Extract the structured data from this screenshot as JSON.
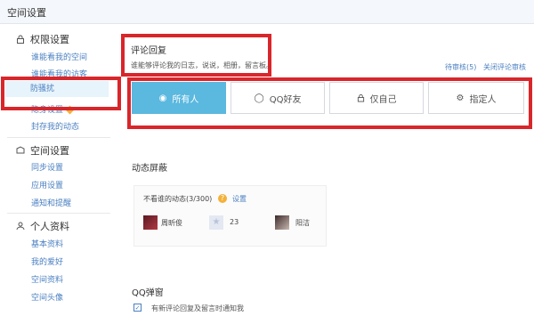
{
  "window": {
    "title": "空间设置"
  },
  "sidebar": {
    "sections": [
      {
        "title": "权限设置",
        "icon": "lock-icon",
        "items": [
          "谁能看我的空间",
          "谁能看我的访客",
          "防骚扰",
          "隐身设置",
          "封存我的动态"
        ]
      },
      {
        "title": "空间设置",
        "icon": "space-icon",
        "items": [
          "同步设置",
          "应用设置",
          "通知和提醒"
        ]
      },
      {
        "title": "个人资料",
        "icon": "person-icon",
        "items": [
          "基本资料",
          "我的爱好",
          "空间资料",
          "空间头像"
        ]
      }
    ],
    "active_item": "防骚扰"
  },
  "comment_reply": {
    "title": "评论回复",
    "description": "谁能够评论我的日志，说说，相册，留言板。",
    "pending_link": "待审核(5)",
    "close_review_link": "关闭评论审核",
    "options": [
      {
        "label": "所有人",
        "icon": "globe-icon",
        "selected": true
      },
      {
        "label": "QQ好友",
        "icon": "bubble-icon",
        "selected": false
      },
      {
        "label": "仅自己",
        "icon": "lock-icon",
        "selected": false
      },
      {
        "label": "指定人",
        "icon": "gear-icon",
        "selected": false
      }
    ]
  },
  "feed_block": {
    "title": "动态屏蔽",
    "not_see_label": "不看谁的动态(3/300)",
    "settings_link": "设置",
    "people": [
      {
        "name": "周昕俊"
      },
      {
        "name": "23"
      },
      {
        "name": "阳洁"
      }
    ]
  },
  "qq_popup": {
    "title": "QQ弹窗",
    "checkbox_label": "有新评论回复及留言时通知我",
    "checked": true
  },
  "colors": {
    "accent": "#5bb8df",
    "link": "#4a7fc1",
    "highlight": "#d9262b",
    "badge": "#f3b13a"
  }
}
